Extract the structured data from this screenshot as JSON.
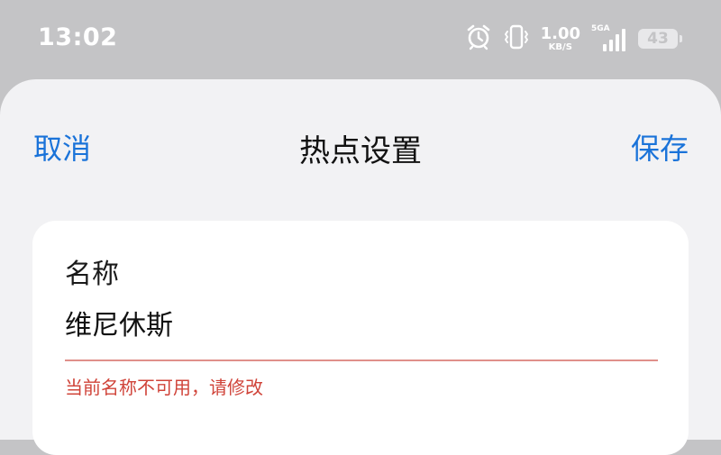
{
  "status_bar": {
    "time": "13:02",
    "network_speed_value": "1.00",
    "network_speed_unit": "KB/S",
    "network_type": "5GA",
    "battery_level": "43",
    "icons": [
      "alarm-icon",
      "vibrate-icon",
      "signal-icon",
      "battery-icon"
    ]
  },
  "nav": {
    "cancel_label": "取消",
    "title": "热点设置",
    "save_label": "保存"
  },
  "form": {
    "name_label": "名称",
    "name_value": "维尼休斯",
    "name_error": "当前名称不可用，请修改"
  },
  "colors": {
    "accent": "#1a73d9",
    "error": "#d0443a",
    "error_underline": "#e0908a",
    "sheet_background": "#f2f2f4",
    "status_bar_background": "#c4c4c6"
  }
}
